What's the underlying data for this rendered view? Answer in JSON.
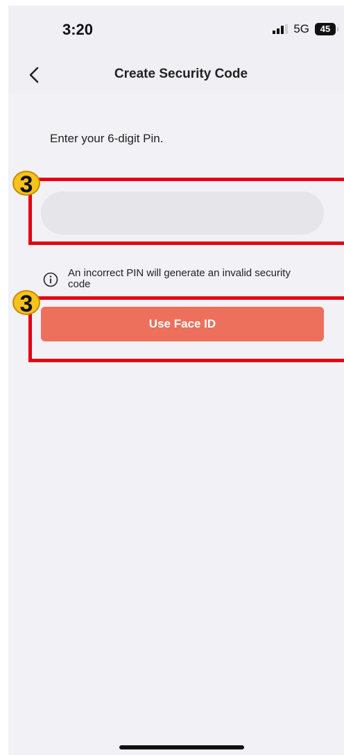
{
  "status_bar": {
    "time": "3:20",
    "network": "5G",
    "battery": "45"
  },
  "nav": {
    "title": "Create Security Code"
  },
  "pin": {
    "prompt": "Enter your 6-digit Pin.",
    "value": "",
    "placeholder": ""
  },
  "info": {
    "text": "An incorrect PIN will generate an invalid security code"
  },
  "face_id_button": {
    "label": "Use Face ID"
  },
  "annotations": [
    {
      "badge": "3"
    },
    {
      "badge": "3"
    }
  ],
  "colors": {
    "accent": "#ec705b",
    "annotation": "#e50012",
    "badge": "#f6c31c"
  }
}
